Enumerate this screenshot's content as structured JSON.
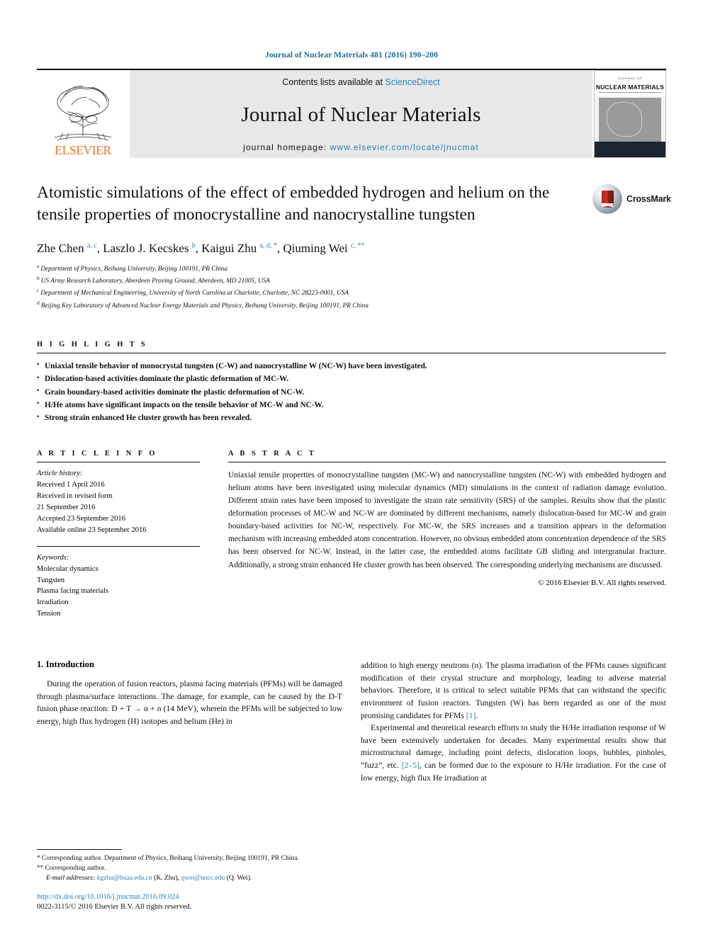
{
  "running_head": "Journal of Nuclear Materials 481 (2016) 190–200",
  "masthead": {
    "publisher": "ELSEVIER",
    "contents_prefix": "Contents lists available at ",
    "contents_link": "ScienceDirect",
    "journal_name": "Journal of Nuclear Materials",
    "homepage_prefix": "journal homepage: ",
    "homepage_url": "www.elsevier.com/locate/jnucmat",
    "cover": {
      "title": "NUCLEAR MATERIALS",
      "superlabel": "JOURNAL OF"
    }
  },
  "article": {
    "title": "Atomistic simulations of the effect of embedded hydrogen and helium on the tensile properties of monocrystalline and nanocrystalline tungsten",
    "crossmark_label": "CrossMark",
    "authors_html": "Zhe Chen <sup>a, c</sup>, Laszlo J. Kecskes <sup>b</sup>, Kaigui Zhu <sup>a, d, *</sup>, Qiuming Wei <sup>c, **</sup>",
    "affiliations": [
      {
        "mark": "a",
        "text": "Department of Physics, Beihang University, Beijing 100191, PR China"
      },
      {
        "mark": "b",
        "text": "US Army Research Laboratory, Aberdeen Proving Ground, Aberdeen, MD 21005, USA"
      },
      {
        "mark": "c",
        "text": "Department of Mechanical Engineering, University of North Carolina at Charlotte, Charlotte, NC 28223-0001, USA"
      },
      {
        "mark": "d",
        "text": "Beijing Key Laboratory of Advanced Nuclear Energy Materials and Physics, Beihang University, Beijing 100191, PR China"
      }
    ]
  },
  "highlights": {
    "heading": "H I G H L I G H T S",
    "items": [
      "Uniaxial tensile behavior of monocrystal tungsten (C-W) and nanocrystalline W (NC-W) have been investigated.",
      "Dislocation-based activities dominate the plastic deformation of MC-W.",
      "Grain boundary-based activities dominate the plastic deformation of NC-W.",
      "H/He atoms have significant impacts on the tensile behavior of MC-W and NC-W.",
      "Strong strain enhanced He cluster growth has been revealed."
    ]
  },
  "article_info": {
    "heading": "A R T I C L E   I N F O",
    "history_title": "Article history:",
    "history_lines": [
      "Received 1 April 2016",
      "Received in revised form",
      "21 September 2016",
      "Accepted 23 September 2016",
      "Available online 23 September 2016"
    ],
    "keywords_title": "Keywords:",
    "keywords": [
      "Molecular dynamics",
      "Tungsten",
      "Plasma facing materials",
      "Irradiation",
      "Tension"
    ]
  },
  "abstract": {
    "heading": "A B S T R A C T",
    "text": "Uniaxial tensile properties of monocrystalline tungsten (MC-W) and nanocrystalline tungsten (NC-W) with embedded hydrogen and helium atoms have been investigated using molecular dynamics (MD) simulations in the context of radiation damage evolution. Different strain rates have been imposed to investigate the strain rate sensitivity (SRS) of the samples. Results show that the plastic deformation processes of MC-W and NC-W are dominated by different mechanisms, namely dislocation-based for MC-W and grain boundary-based activities for NC-W, respectively. For MC-W, the SRS increases and a transition appears in the deformation mechanism with increasing embedded atom concentration. However, no obvious embedded atom concentration dependence of the SRS has been observed for NC-W. Instead, in the latter case, the embedded atoms facilitate GB sliding and intergranular fracture. Additionally, a strong strain enhanced He cluster growth has been observed. The corresponding underlying mechanisms are discussed.",
    "copyright": "© 2016 Elsevier B.V. All rights reserved."
  },
  "body": {
    "section_heading": "1.  Introduction",
    "left_paragraph": "During the operation of fusion reactors, plasma facing materials (PFMs) will be damaged through plasma/surface interactions. The damage, for example, can be caused by the D-T fusion phase reaction: D + T → α + n (14 MeV), wherein the PFMs will be subjected to low energy, high flux hydrogen (H) isotopes and helium (He) in",
    "right_paragraph_1_a": "addition to high energy neutrons (n). The plasma irradiation of the PFMs causes significant modification of their crystal structure and morphology, leading to adverse material behaviors. Therefore, it is critical to select suitable PFMs that can withstand the specific environment of fusion reactors. Tungsten (W) has been regarded as one of the most promising candidates for PFMs ",
    "right_paragraph_1_ref": "[1]",
    "right_paragraph_1_b": ".",
    "right_paragraph_2_a": "Experimental and theoretical research efforts to study the H/He irradiation response of W have been extensively undertaken for decades. Many experimental results show that microstructural damage, including point defects, dislocation loops, bubbles, pinholes, “fuzz”, etc. ",
    "right_paragraph_2_ref": "[2–5]",
    "right_paragraph_2_b": ", can be formed due to the exposure to H/He irradiation. For the case of low energy, high flux He irradiation at"
  },
  "footer": {
    "note_1_mark": "*",
    "note_1": "Corresponding author. Department of Physics, Beihang University, Beijing 100191, PR China.",
    "note_2_mark": "**",
    "note_2": "Corresponding author.",
    "email_label": "E-mail addresses:",
    "email_1": "kgzhu@buaa.edu.cn",
    "email_1_owner": "(K. Zhu)",
    "email_2": "qwei@uncc.edu",
    "email_2_owner": "(Q. Wei)",
    "doi": "http://dx.doi.org/10.1016/j.jnucmat.2016.09.024",
    "issn": "0022-3115/© 2016 Elsevier B.V. All rights reserved."
  },
  "colors": {
    "link": "#2a7fb8",
    "elsevier_orange": "#E87722",
    "masthead_bg": "#e8e8e8"
  }
}
